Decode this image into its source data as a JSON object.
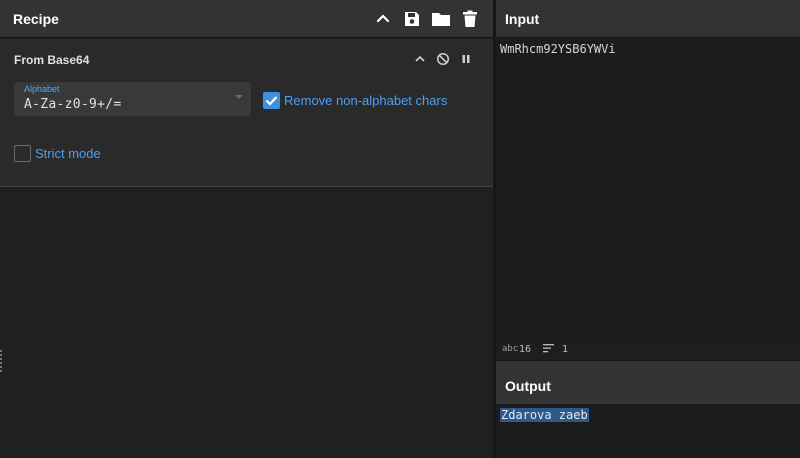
{
  "recipe": {
    "title": "Recipe",
    "icons": [
      "chevron-up-icon",
      "save-icon",
      "folder-icon",
      "trash-icon"
    ],
    "operation": {
      "name": "From Base64",
      "icons": [
        "chevron-up-icon",
        "disable-icon",
        "pause-icon"
      ],
      "alphabet": {
        "label": "Alphabet",
        "value": "A-Za-z0-9+/="
      },
      "remove_non_alphabet": {
        "label": "Remove non-alphabet chars",
        "checked": true
      },
      "strict_mode": {
        "label": "Strict mode",
        "checked": false
      }
    }
  },
  "input": {
    "title": "Input",
    "text": "WmRhcm92YSB6YWVi",
    "status": {
      "length_icon": "abc",
      "length": "16",
      "lines": "1"
    }
  },
  "output": {
    "title": "Output",
    "text": "Zdarova zaeb"
  },
  "colors": {
    "accent": "#3d8fe0",
    "header": "#333333",
    "background": "#202020"
  }
}
